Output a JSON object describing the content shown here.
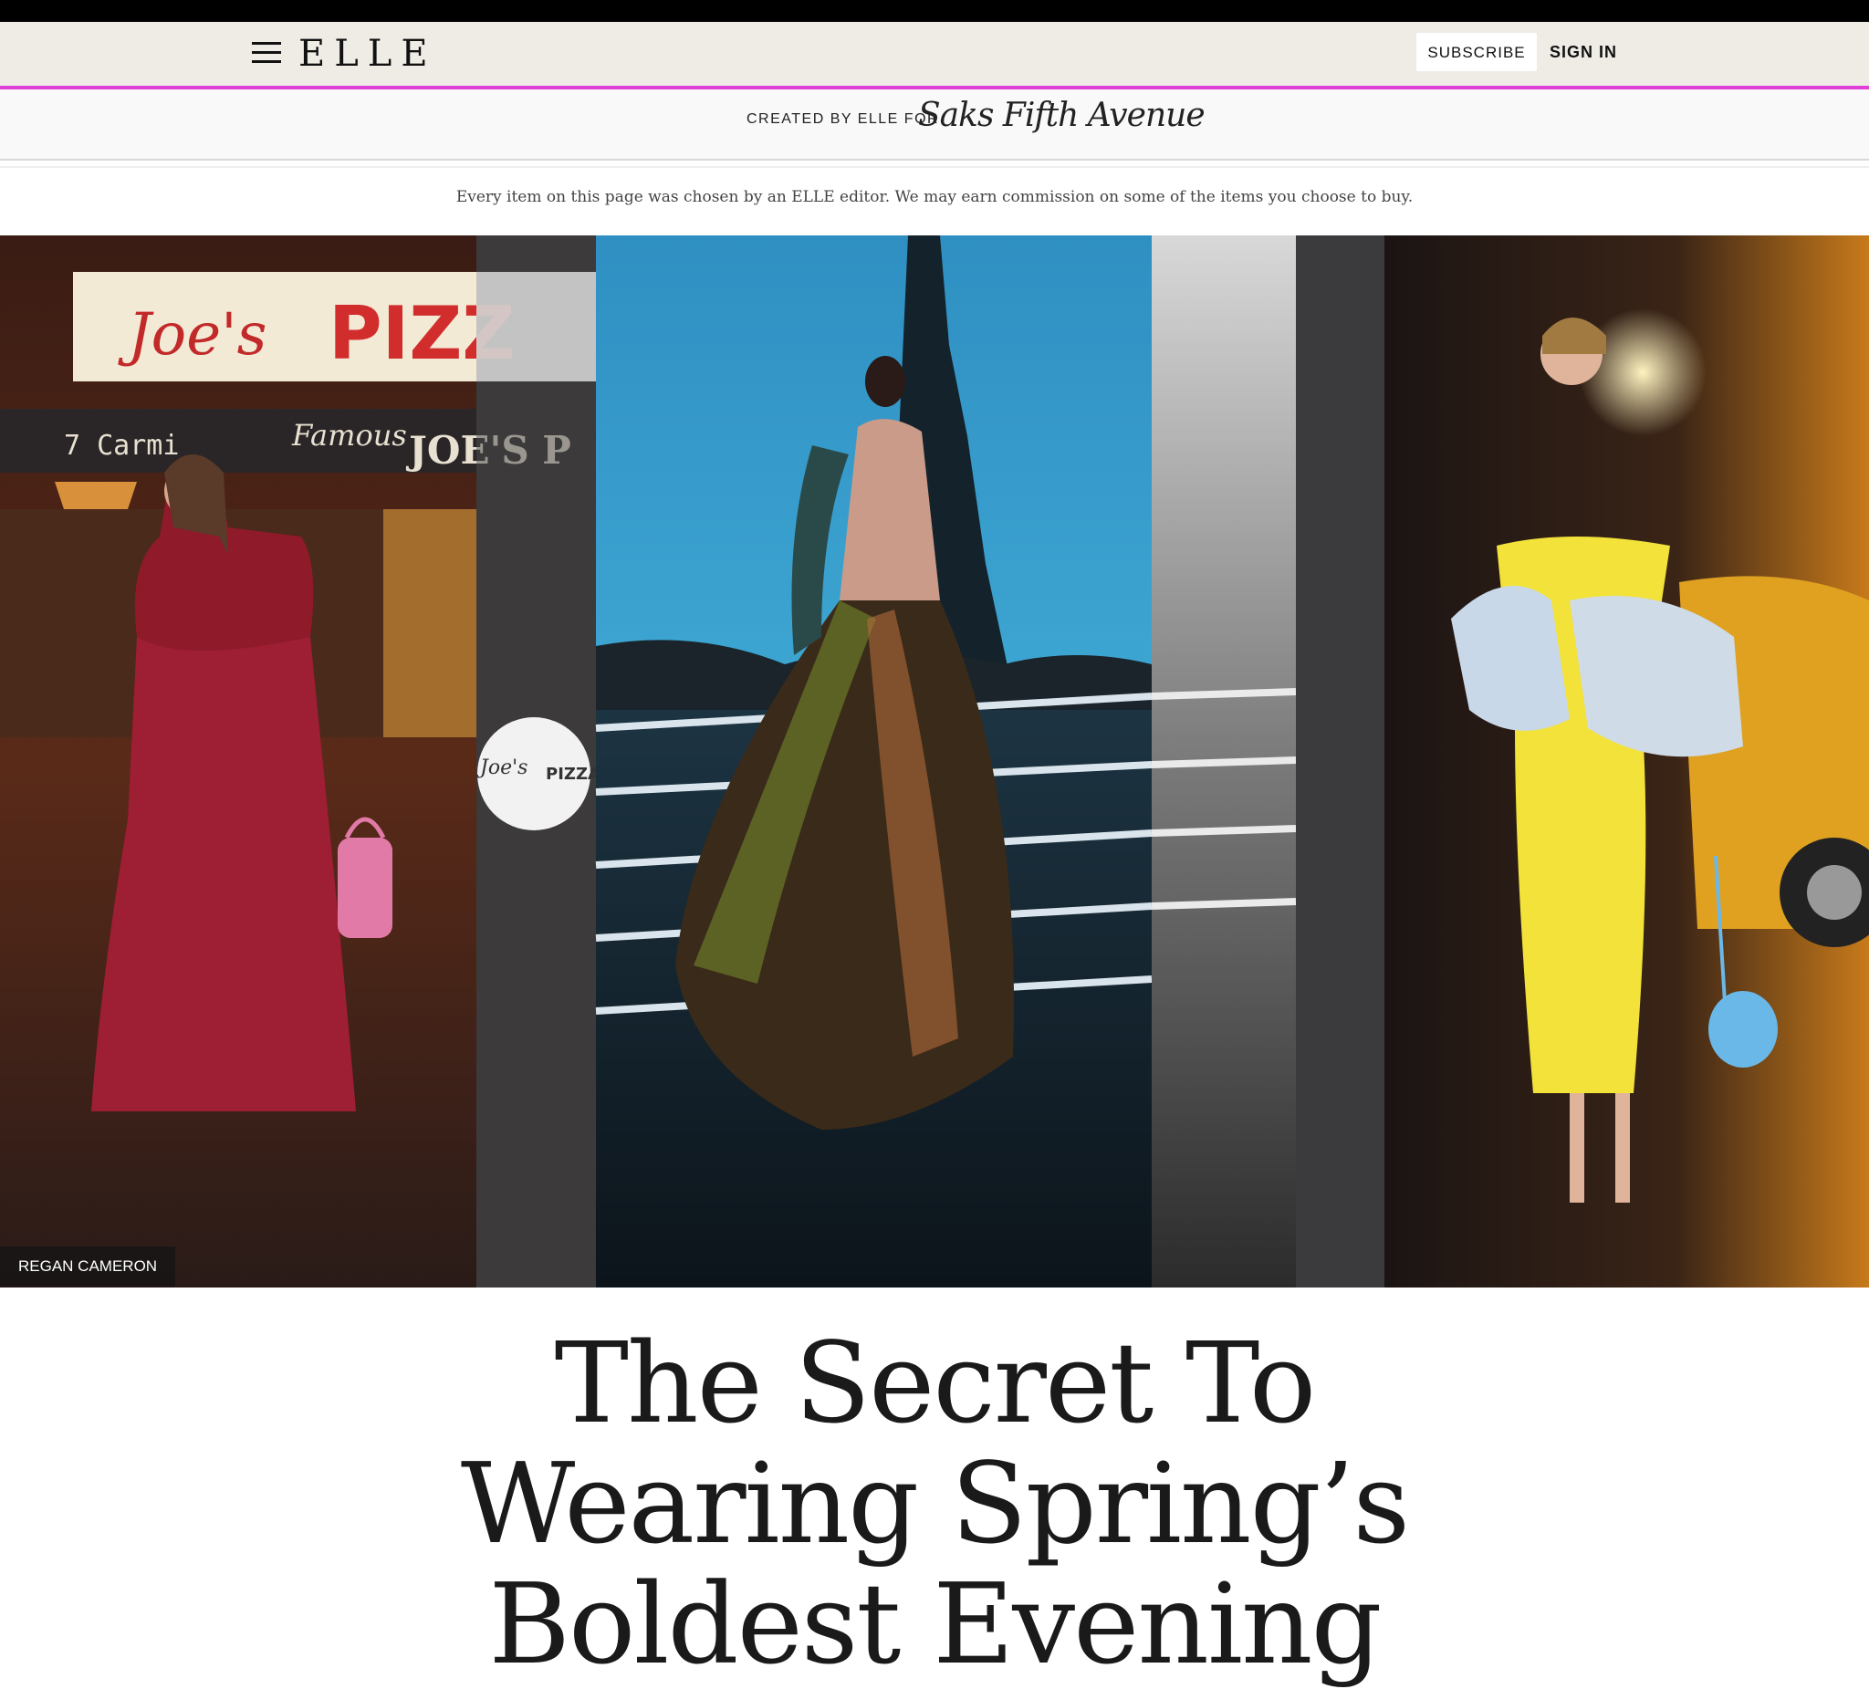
{
  "header": {
    "logo": "ELLE",
    "subscribe_label": "SUBSCRIBE",
    "signin_label": "SIGN IN",
    "accent_color": "#e040d8",
    "background_color": "#efece6"
  },
  "sponsor": {
    "label": "CREATED BY ELLE FOR",
    "brand": "Saks Fifth Avenue"
  },
  "disclaimer": "Every item on this page was chosen by an ELLE editor. We may earn commission on some of the items you choose to buy.",
  "hero": {
    "photo_credit": "REGAN CAMERON",
    "signs": {
      "pizza_sign_script": "Joe's",
      "pizza_sign_bold": "PIZZ",
      "address": "7 Carmi",
      "famous": "Famous",
      "joes": "JOE'S P",
      "round_sign_script": "Joe's",
      "round_sign_text": "PIZZA"
    }
  },
  "article": {
    "headline_lines": [
      "The Secret To",
      "Wearing Spring’s",
      "Boldest Evening"
    ]
  }
}
